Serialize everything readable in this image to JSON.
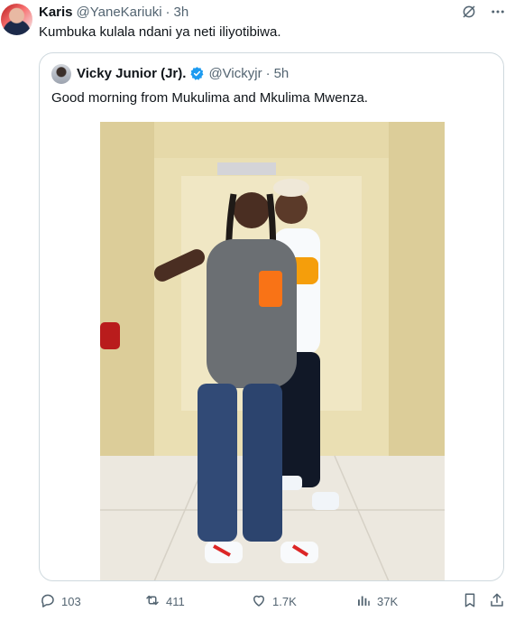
{
  "tweet": {
    "author_name": "Karis",
    "author_handle": "@YaneKariuki",
    "separator": "·",
    "time": "3h",
    "text": "Kumbuka kulala ndani ya neti iliyotibiwa."
  },
  "quoted_tweet": {
    "author_name": "Vicky Junior (Jr).",
    "author_handle": "@Vickyjr",
    "separator": "·",
    "time": "5h",
    "text": "Good morning from Mukulima and Mkulima Mwenza.",
    "verified_icon": "verified-badge-icon",
    "verified_color": "#1d9bf0"
  },
  "actions": {
    "replies": "103",
    "retweets": "411",
    "likes": "1.7K",
    "views": "37K"
  },
  "icons": {
    "grok": "grok-icon",
    "more": "more-icon",
    "reply": "reply-icon",
    "retweet": "retweet-icon",
    "like": "heart-icon",
    "views": "views-icon",
    "bookmark": "bookmark-icon",
    "share": "share-icon"
  },
  "colors": {
    "text_primary": "#0f1419",
    "text_secondary": "#536471",
    "border": "#cfd9de",
    "accent": "#1d9bf0"
  }
}
